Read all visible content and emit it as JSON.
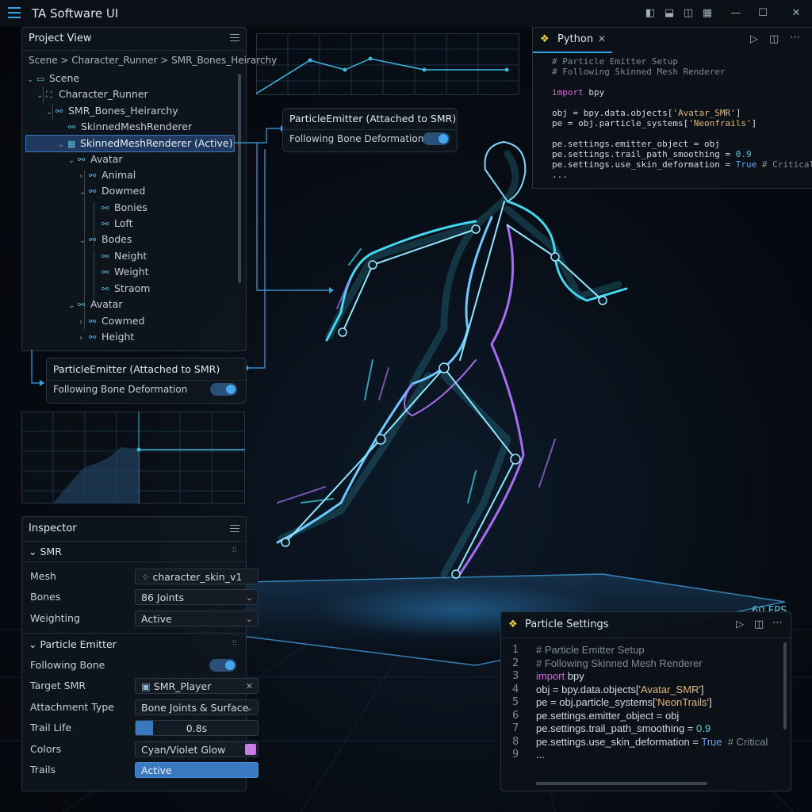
{
  "app": {
    "title": "TA Software UI"
  },
  "project_view": {
    "title": "Project View",
    "breadcrumb": "Scene > Character_Runner > SMR_Bones_Heirarchy",
    "tree": [
      {
        "label": "Scene"
      },
      {
        "label": "Character_Runner"
      },
      {
        "label": "SMR_Bones_Heirarchy"
      },
      {
        "label": "SkinnedMeshRenderer"
      },
      {
        "label": "SkinnedMeshRenderer (Active)"
      },
      {
        "label": "Avatar"
      },
      {
        "label": "Animal"
      },
      {
        "label": "Dowmed"
      },
      {
        "label": "Bonies"
      },
      {
        "label": "Loft"
      },
      {
        "label": "Bodes"
      },
      {
        "label": "Neight"
      },
      {
        "label": "Weight"
      },
      {
        "label": "Straom"
      },
      {
        "label": "Avatar"
      },
      {
        "label": "Cowmed"
      },
      {
        "label": "Height"
      }
    ]
  },
  "emitter_card": {
    "title": "ParticleEmitter (Attached to SMR)",
    "toggle_label": "Following Bone Deformation",
    "toggle_on": true
  },
  "inspector": {
    "title": "Inspector",
    "smr_section": "SMR",
    "mesh_label": "Mesh",
    "mesh_value": "character_skin_v1",
    "bones_label": "Bones",
    "bones_value": "86 Joints",
    "weighting_label": "Weighting",
    "weighting_value": "Active",
    "emitter_section": "Particle Emitter",
    "following_label": "Following Bone",
    "following_on": true,
    "target_label": "Target SMR",
    "target_value": "SMR_Player",
    "attach_label": "Attachment Type",
    "attach_value": "Bone Joints & Surface",
    "trail_label": "Trail Life",
    "trail_value": "0.8s",
    "trail_fraction": 0.14,
    "colors_label": "Colors",
    "colors_value": "Cyan/Violet Glow",
    "swatch_color": "#c77de8",
    "trails_label": "Trails",
    "trails_value": "Active"
  },
  "python_tab": {
    "title": "Python",
    "lines": [
      "# Particle Emitter Setup",
      "# Following Skinned Mesh Renderer",
      "",
      "import bpy",
      "",
      "obj = bpy.data.objects['Avatar_SMR']",
      "pe = obj.particle_systems['Neonfrails']",
      "",
      "pe.settings.emitter_object = obj",
      "pe.settings.trail_path_smoothing = 0.9",
      "pe.settings.use_skin_deformation = True # Critical",
      "..."
    ]
  },
  "particle_settings": {
    "title": "Particle Settings",
    "line_numbers": [
      "1",
      "2",
      "3",
      "4",
      "5",
      "6",
      "7",
      "8",
      "9"
    ],
    "lines": [
      "# Particle Emitter Setup",
      "# Following Skinned Mesh Renderer",
      "import bpy",
      "obj = bpy.data.objects['Avatar_SMR']",
      "pe = obj.particle_systems['NeonTrails']",
      "pe.settings.emitter_object = obj",
      "pe.settings.trail_path_smoothing = 0.9",
      "pe.settings.use_skin_deformation = True  # Critical",
      "..."
    ]
  },
  "viewport": {
    "fps": "60 FPS"
  },
  "colors": {
    "accent": "#3aa0e8",
    "cyan": "#44d8f0",
    "violet": "#a86cf0"
  }
}
